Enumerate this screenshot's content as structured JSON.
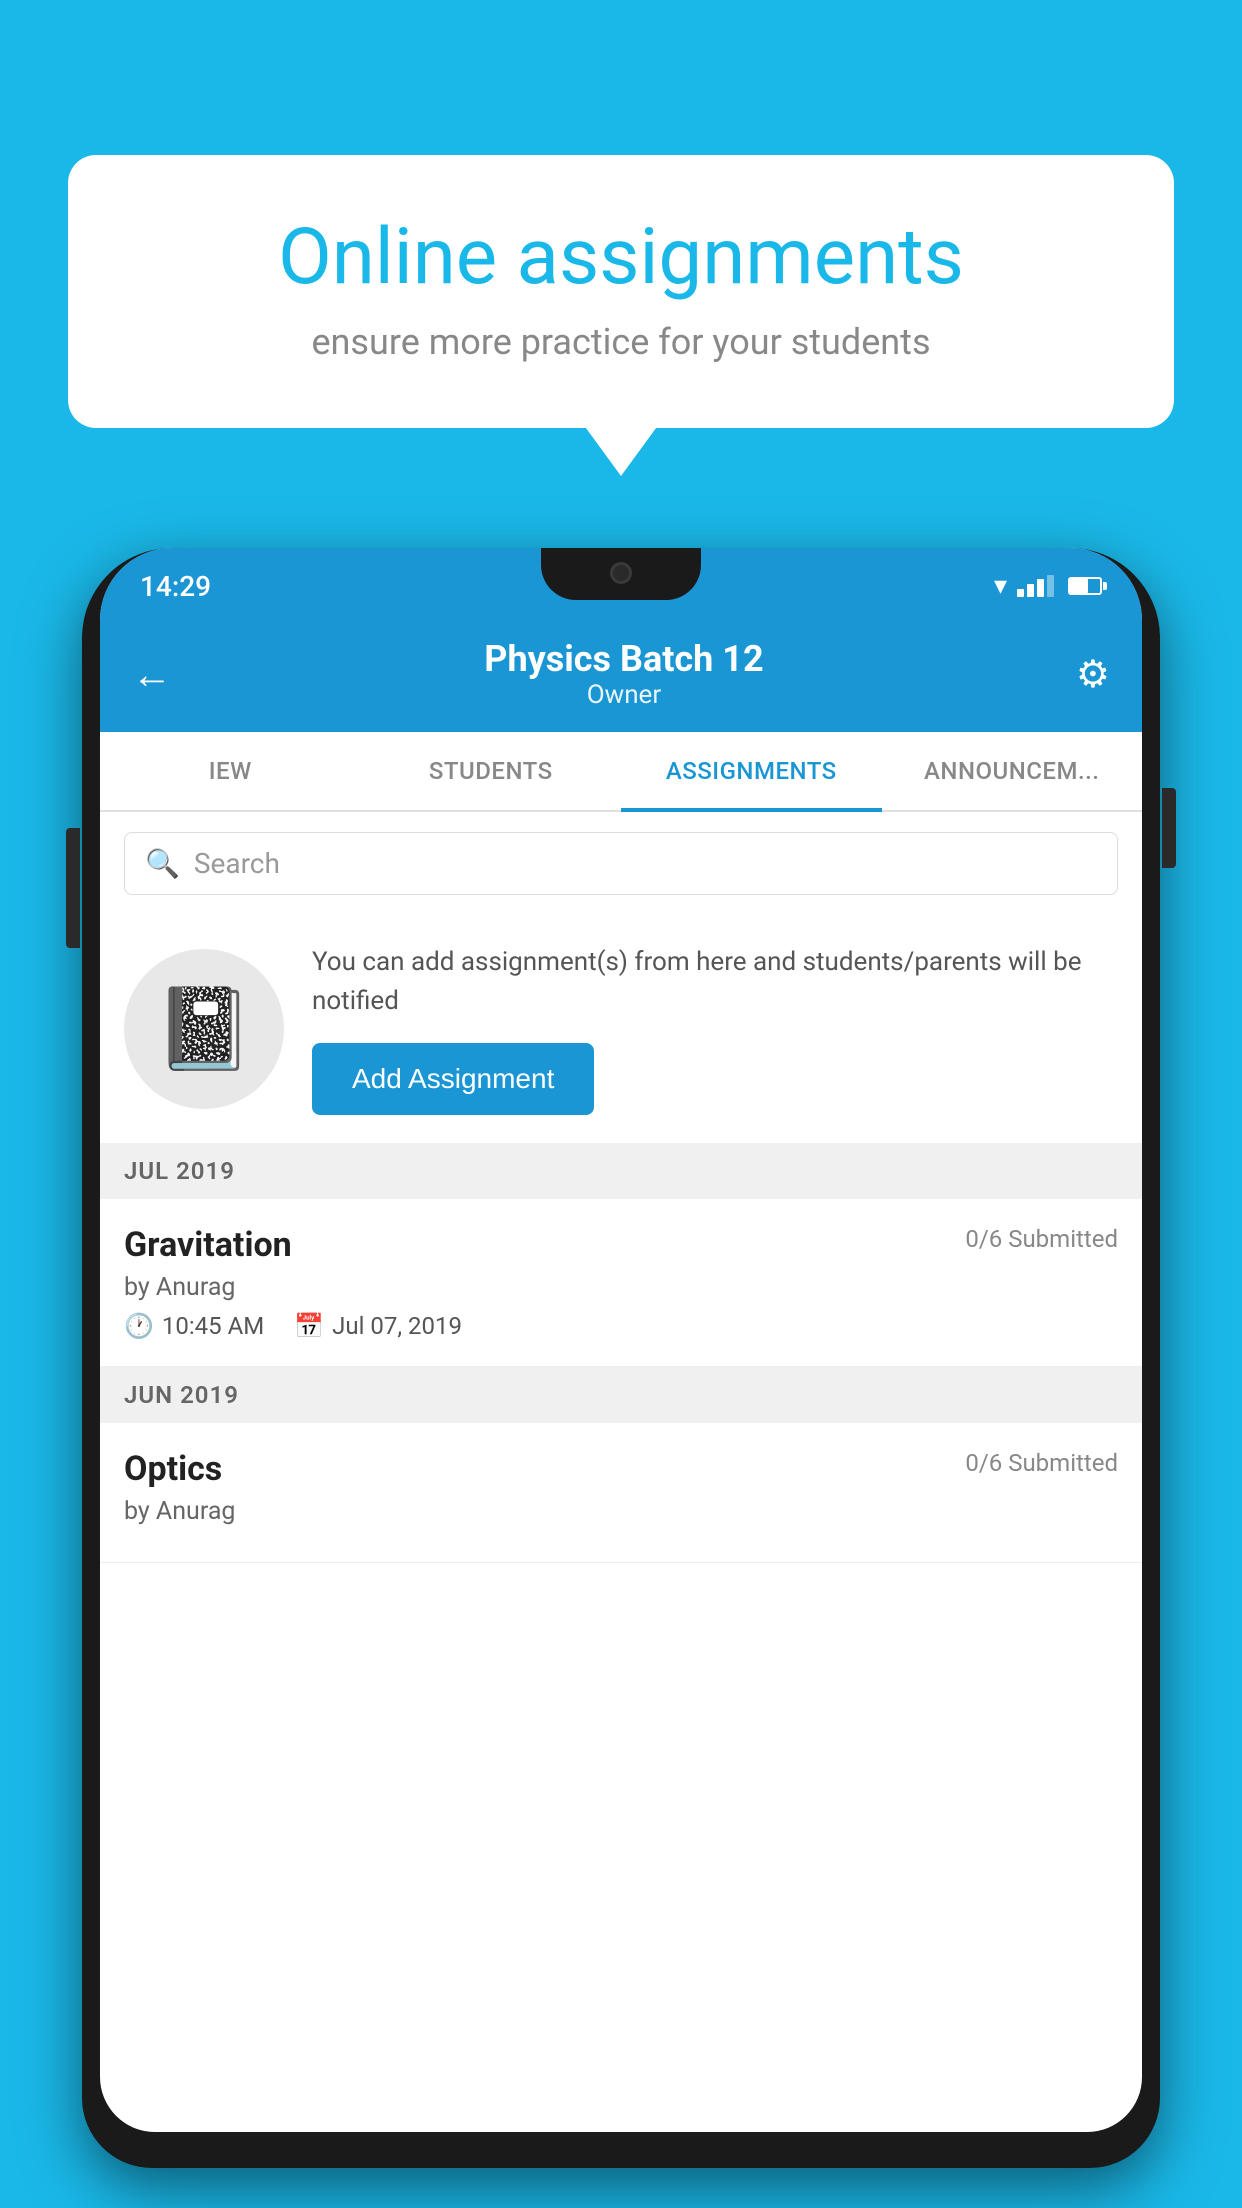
{
  "background_color": "#1ab8e8",
  "speech_bubble": {
    "title": "Online assignments",
    "subtitle": "ensure more practice for your students"
  },
  "phone": {
    "status_bar": {
      "time": "14:29"
    },
    "header": {
      "title": "Physics Batch 12",
      "subtitle": "Owner",
      "back_label": "←",
      "settings_label": "⚙"
    },
    "tabs": [
      {
        "label": "IEW",
        "active": false
      },
      {
        "label": "STUDENTS",
        "active": false
      },
      {
        "label": "ASSIGNMENTS",
        "active": true
      },
      {
        "label": "ANNOUNCEM...",
        "active": false
      }
    ],
    "search": {
      "placeholder": "Search"
    },
    "add_assignment": {
      "description": "You can add assignment(s) from here and students/parents will be notified",
      "button_label": "Add Assignment"
    },
    "sections": [
      {
        "month": "JUL 2019",
        "assignments": [
          {
            "name": "Gravitation",
            "submitted": "0/6 Submitted",
            "author": "by Anurag",
            "time": "10:45 AM",
            "date": "Jul 07, 2019"
          }
        ]
      },
      {
        "month": "JUN 2019",
        "assignments": [
          {
            "name": "Optics",
            "submitted": "0/6 Submitted",
            "author": "by Anurag",
            "time": "",
            "date": ""
          }
        ]
      }
    ]
  }
}
